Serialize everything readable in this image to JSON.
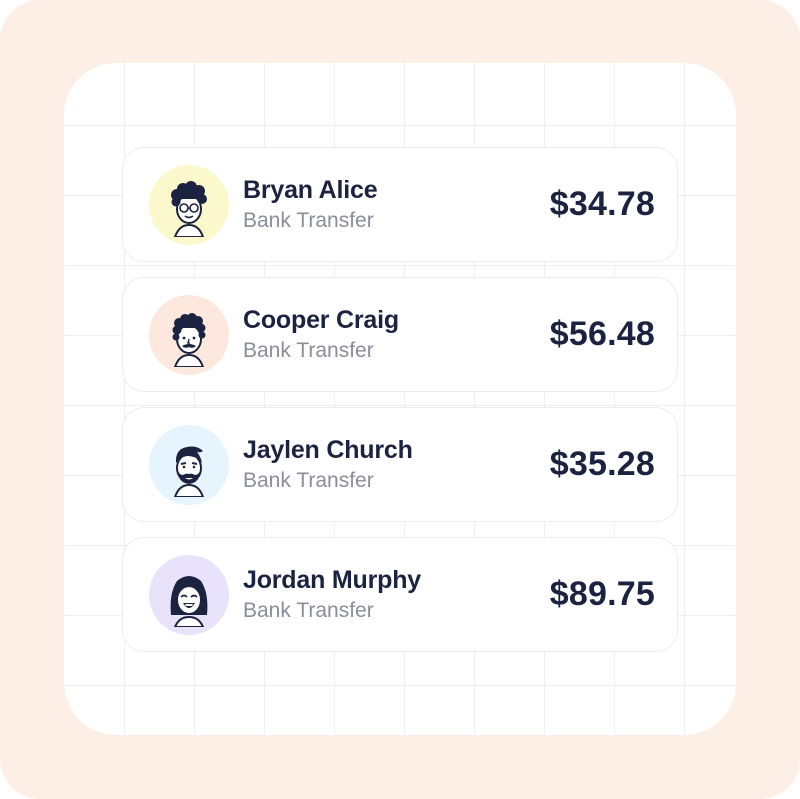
{
  "colors": {
    "frame_background": "#fdeee6",
    "card_background": "#ffffff",
    "text_primary": "#1c2340",
    "text_secondary": "#8b8d9a"
  },
  "transactions": [
    {
      "name": "Bryan Alice",
      "method": "Bank Transfer",
      "amount": "$34.78",
      "avatar_icon": "curly-hair-glasses-face-icon",
      "avatar_color": "#fbf9cc"
    },
    {
      "name": "Cooper Craig",
      "method": "Bank Transfer",
      "amount": "$56.48",
      "avatar_icon": "curly-hair-mustache-face-icon",
      "avatar_color": "#fde8de"
    },
    {
      "name": "Jaylen Church",
      "method": "Bank Transfer",
      "amount": "$35.28",
      "avatar_icon": "bearded-face-icon",
      "avatar_color": "#e6f4fd"
    },
    {
      "name": "Jordan Murphy",
      "method": "Bank Transfer",
      "amount": "$89.75",
      "avatar_icon": "laughing-woman-face-icon",
      "avatar_color": "#e9e2fb"
    }
  ]
}
